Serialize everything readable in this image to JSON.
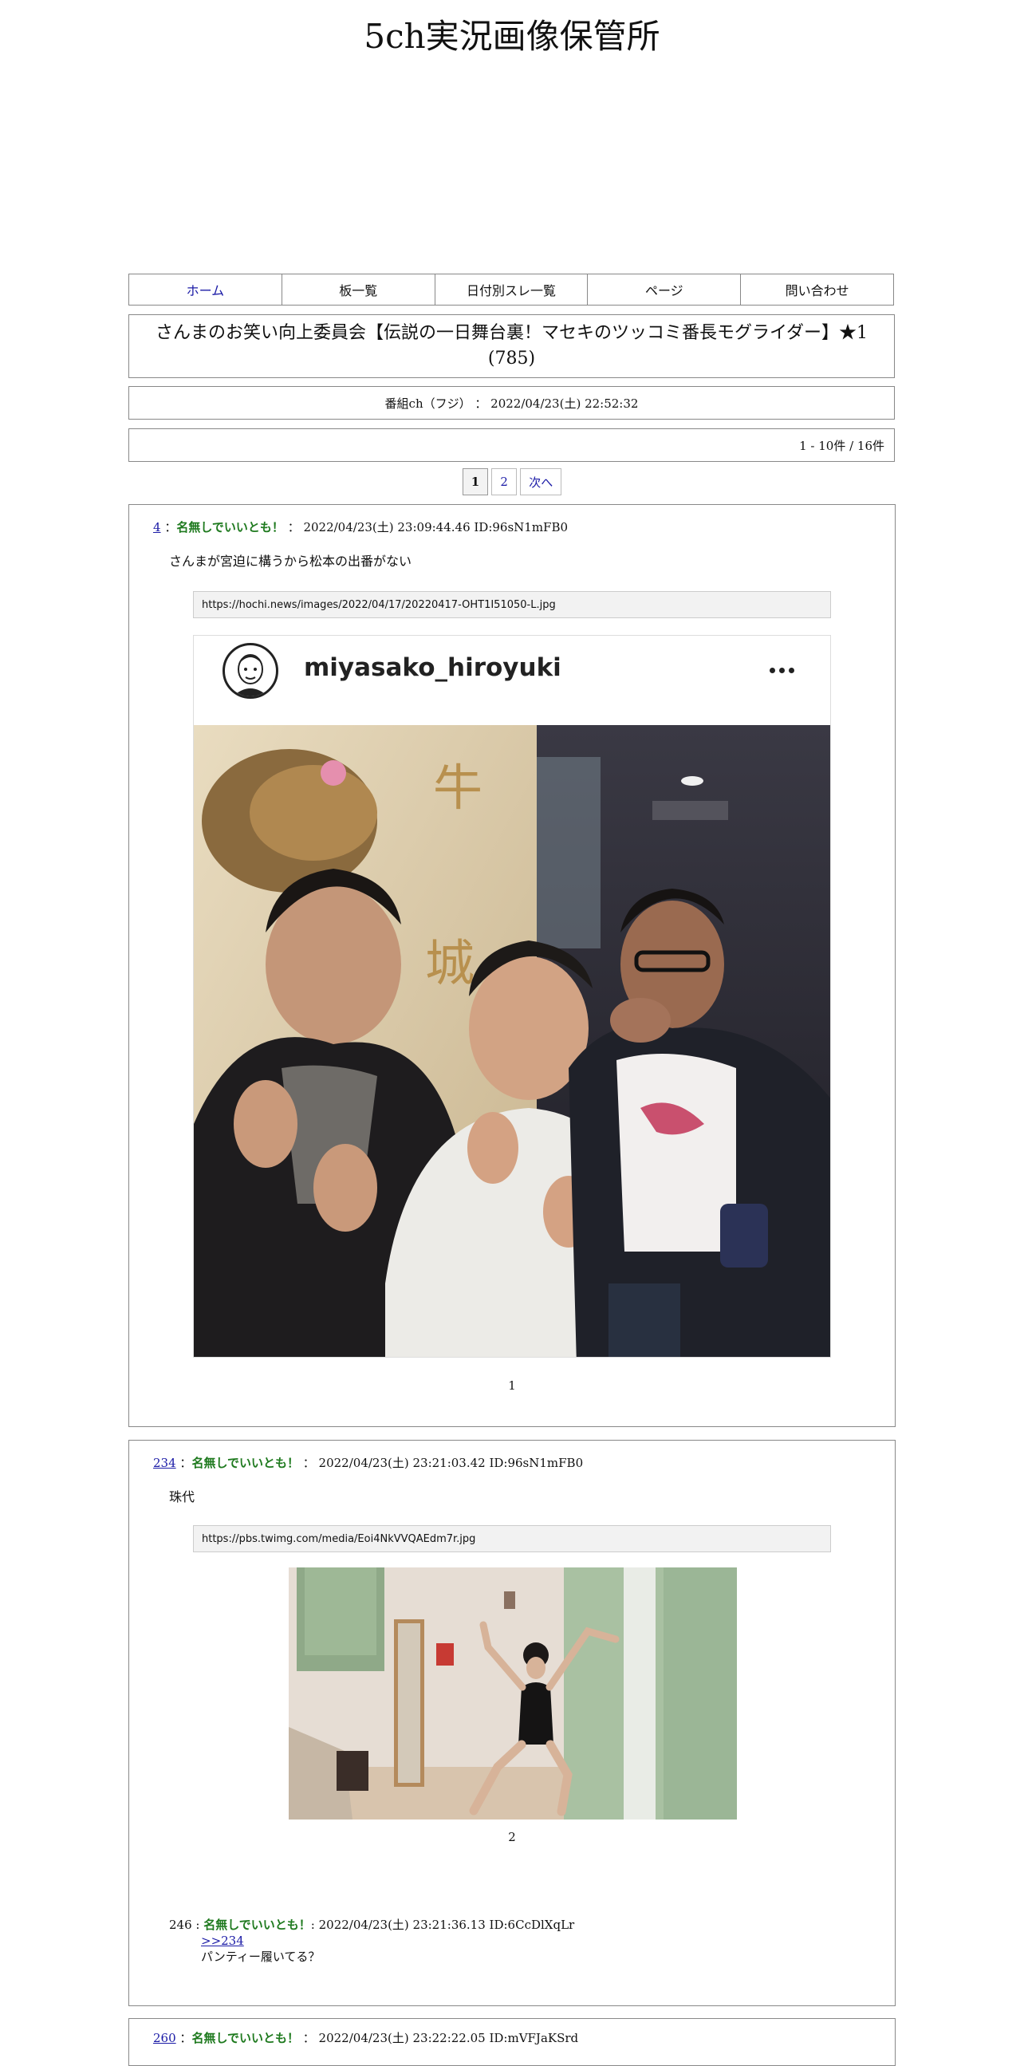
{
  "site": {
    "title": "5ch実況画像保管所"
  },
  "nav": [
    {
      "label": "ホーム"
    },
    {
      "label": "板一覧"
    },
    {
      "label": "日付別スレ一覧"
    },
    {
      "label": "ページ"
    },
    {
      "label": "問い合わせ"
    }
  ],
  "thread": {
    "title": "さんまのお笑い向上委員会【伝説の一日舞台裏！マセキのツッコミ番長モグライダー】★1 (785)",
    "board_line": "番組ch（フジ） ： 2022/04/23(土) 22:52:32",
    "count": "1 - 10件 / 16件"
  },
  "pager": {
    "current": "1",
    "next_page": "2",
    "next_label": "次へ"
  },
  "posts": [
    {
      "num": "4",
      "sep": "：",
      "name": "名無しでいいとも！",
      "meta": "： 2022/04/23(土) 23:09:44.46 ID:96sN1mFB0",
      "body": "さんまが宮迫に構うから松本の出番がない",
      "image_url": "https://hochi.news/images/2022/04/17/20220417-OHT1I51050-L.jpg",
      "image_username": "miyasako_hiroyuki",
      "image_caption": "1"
    },
    {
      "num": "234",
      "sep": "：",
      "name": "名無しでいいとも！",
      "meta": "： 2022/04/23(土) 23:21:03.42 ID:96sN1mFB0",
      "body": "珠代",
      "image_url": "https://pbs.twimg.com/media/Eoi4NkVVQAEdm7r.jpg",
      "image_caption": "2",
      "reply": {
        "num": "246 :",
        "name": "名無しでいいとも！",
        "meta": ": 2022/04/23(土) 23:21:36.13 ID:6CcDlXqLr",
        "anchor": ">>234",
        "text": "パンティー履いてる？"
      }
    },
    {
      "num": "260",
      "sep": "：",
      "name": "名無しでいいとも！",
      "meta": "： 2022/04/23(土) 23:22:22.05 ID:mVFJaKSrd"
    }
  ],
  "colors": {
    "link": "#1a1aa6",
    "name_green": "#1f7a1f",
    "border": "#888888"
  }
}
